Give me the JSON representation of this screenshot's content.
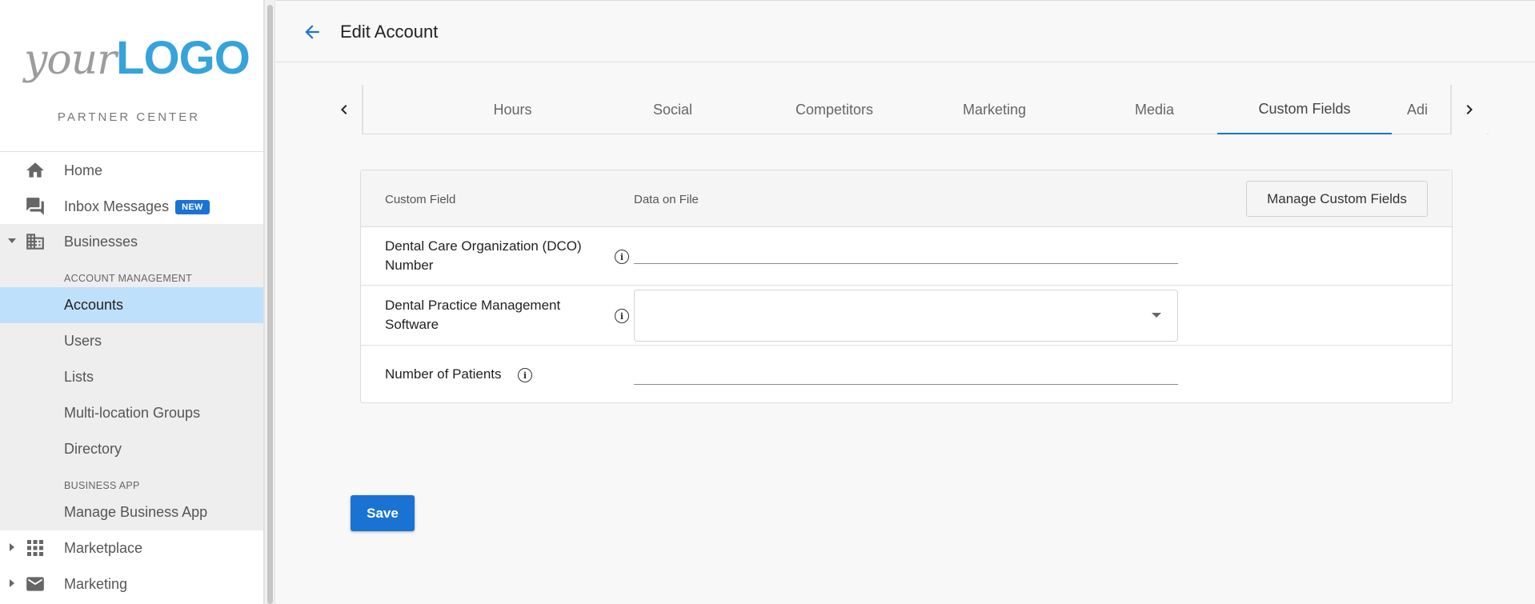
{
  "sidebar": {
    "logo": {
      "prefix": "your",
      "brand": "LOGO"
    },
    "subtitle": "PARTNER CENTER",
    "nav": {
      "home": "Home",
      "inbox": "Inbox Messages",
      "inbox_badge": "NEW",
      "businesses": "Businesses",
      "marketplace": "Marketplace",
      "marketing": "Marketing"
    },
    "account_management": {
      "heading": "ACCOUNT MANAGEMENT",
      "items": [
        "Accounts",
        "Users",
        "Lists",
        "Multi-location Groups",
        "Directory"
      ]
    },
    "business_app": {
      "heading": "BUSINESS APP",
      "items": [
        "Manage Business App"
      ]
    }
  },
  "header": {
    "title": "Edit Account"
  },
  "tabs": {
    "items": [
      "Hours",
      "Social",
      "Competitors",
      "Marketing",
      "Media",
      "Custom Fields",
      "Adi"
    ],
    "active": "Custom Fields"
  },
  "custom_fields": {
    "col_field": "Custom Field",
    "col_data": "Data on File",
    "manage_button": "Manage Custom Fields",
    "rows": [
      {
        "label_line1": "Dental Care Organization (DCO)",
        "label_line2": "Number",
        "value": ""
      },
      {
        "label_line1": "Dental Practice Management",
        "label_line2": "Software",
        "value": ""
      },
      {
        "label_line1": "Number of Patients",
        "value": ""
      }
    ]
  },
  "actions": {
    "save": "Save"
  },
  "colors": {
    "accent": "#1a73d3",
    "active_nav": "#bfe0fa",
    "logo_blue": "#36a3dc"
  }
}
